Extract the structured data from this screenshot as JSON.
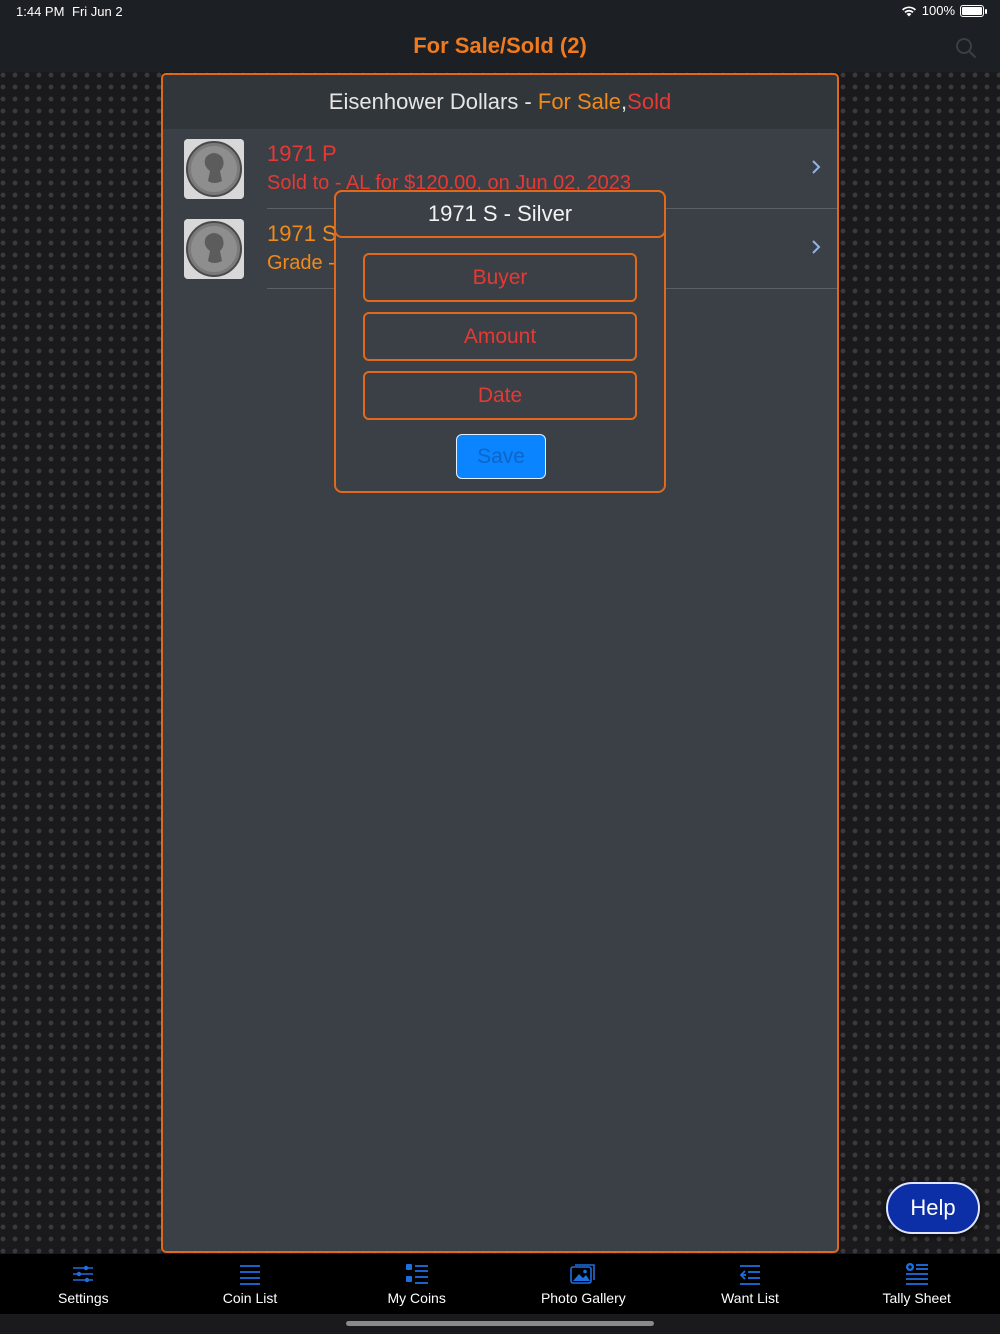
{
  "status_bar": {
    "time": "1:44 PM",
    "date": "Fri Jun 2",
    "battery": "100%",
    "battery_level": 1.0
  },
  "nav": {
    "title": "For Sale/Sold (2)",
    "search_icon": "magnifying-glass-icon"
  },
  "panel": {
    "header": {
      "prefix": "Eisenhower Dollars - ",
      "for_sale": "For Sale",
      "comma": ",",
      "sold": "Sold"
    },
    "coins": [
      {
        "title": "1971 P",
        "subtitle": "Sold to - AL for $120.00, on Jun 02, 2023",
        "color": "#e53935"
      },
      {
        "title": "1971 S",
        "subtitle": "Grade - ",
        "color": "#f08a1a"
      }
    ]
  },
  "dialog": {
    "title": "1971 S - Silver",
    "buyer_label": "Buyer",
    "amount_label": "Amount",
    "date_label": "Date",
    "save_label": "Save"
  },
  "help_label": "Help",
  "tabs": [
    {
      "label": "Settings",
      "icon": "sliders-icon"
    },
    {
      "label": "Coin List",
      "icon": "list-icon"
    },
    {
      "label": "My Coins",
      "icon": "bulleted-list-icon"
    },
    {
      "label": "Photo Gallery",
      "icon": "photo-gallery-icon"
    },
    {
      "label": "Want List",
      "icon": "want-list-icon"
    },
    {
      "label": "Tally Sheet",
      "icon": "tally-sheet-icon"
    }
  ],
  "colors": {
    "accent": "#f07a1f",
    "sold": "#e53935",
    "for_sale": "#f08a1a",
    "tab_icon": "#1e6fe0",
    "save": "#0a84ff"
  }
}
